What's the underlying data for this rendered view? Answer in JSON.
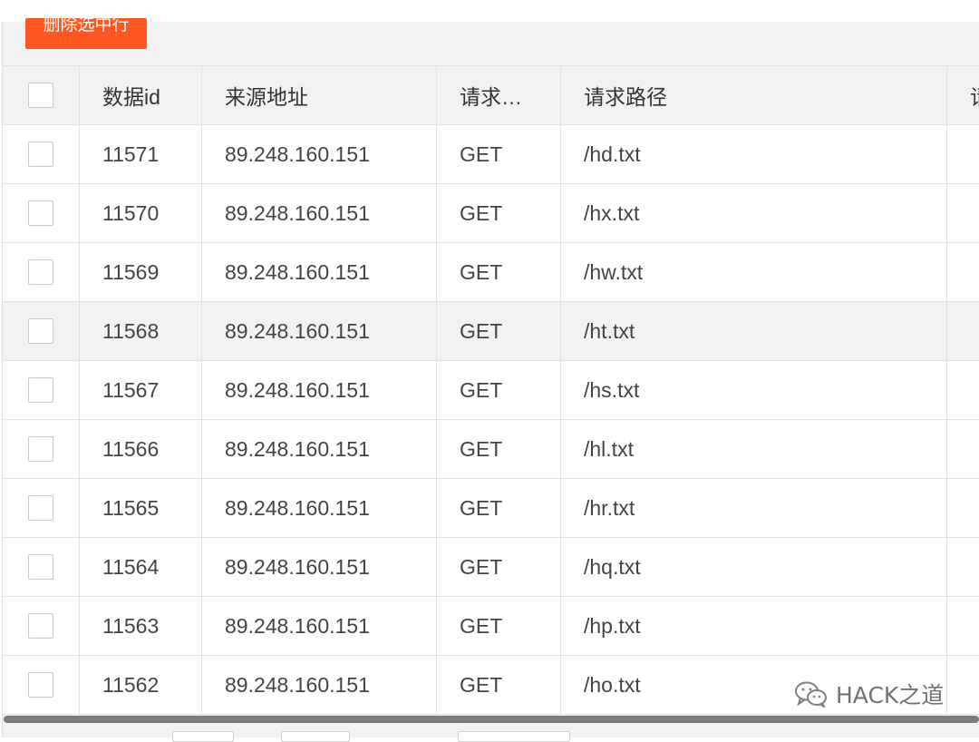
{
  "toolbar": {
    "delete_selected_label": "删除选中行"
  },
  "table": {
    "columns": [
      "数据id",
      "来源地址",
      "请求…",
      "请求路径",
      "请"
    ],
    "rows": [
      {
        "id": "11571",
        "source": "89.248.160.151",
        "method": "GET",
        "path": "/hd.txt"
      },
      {
        "id": "11570",
        "source": "89.248.160.151",
        "method": "GET",
        "path": "/hx.txt"
      },
      {
        "id": "11569",
        "source": "89.248.160.151",
        "method": "GET",
        "path": "/hw.txt"
      },
      {
        "id": "11568",
        "source": "89.248.160.151",
        "method": "GET",
        "path": "/ht.txt"
      },
      {
        "id": "11567",
        "source": "89.248.160.151",
        "method": "GET",
        "path": "/hs.txt"
      },
      {
        "id": "11566",
        "source": "89.248.160.151",
        "method": "GET",
        "path": "/hl.txt"
      },
      {
        "id": "11565",
        "source": "89.248.160.151",
        "method": "GET",
        "path": "/hr.txt"
      },
      {
        "id": "11564",
        "source": "89.248.160.151",
        "method": "GET",
        "path": "/hq.txt"
      },
      {
        "id": "11563",
        "source": "89.248.160.151",
        "method": "GET",
        "path": "/hp.txt"
      },
      {
        "id": "11562",
        "source": "89.248.160.151",
        "method": "GET",
        "path": "/ho.txt"
      }
    ]
  },
  "watermark": {
    "text": "HACK之道",
    "icon": "wechat-icon"
  },
  "colors": {
    "delete_button": "#ff5722",
    "header_bg": "#f2f2f2",
    "border": "#e2e2e2"
  }
}
